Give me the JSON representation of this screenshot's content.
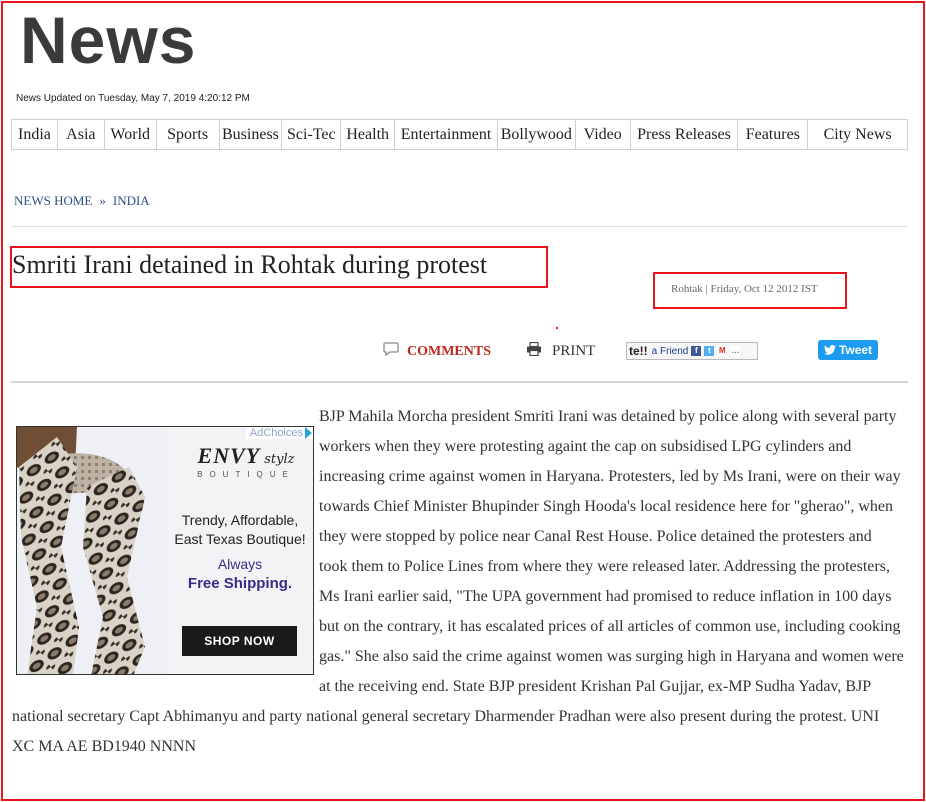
{
  "site": {
    "logo": "News",
    "updated": "News Updated on Tuesday, May 7, 2019 4:20:12 PM"
  },
  "nav": {
    "items": [
      {
        "label": "India"
      },
      {
        "label": "Asia"
      },
      {
        "label": "World"
      },
      {
        "label": "Sports"
      },
      {
        "label": "Business"
      },
      {
        "label": "Sci-Tec"
      },
      {
        "label": "Health"
      },
      {
        "label": "Entertainment"
      },
      {
        "label": "Bollywood"
      },
      {
        "label": "Video"
      },
      {
        "label": "Press Releases"
      },
      {
        "label": "Features"
      },
      {
        "label": "City News"
      }
    ]
  },
  "breadcrumb": {
    "home": "NEWS HOME",
    "separator": "»",
    "section": "INDIA"
  },
  "article": {
    "headline": "Smriti Irani detained in Rohtak during protest",
    "dateline": "Rohtak | Friday, Oct 12 2012 IST",
    "body": "BJP Mahila Morcha president Smriti Irani was detained by police along with several party workers when they were protesting againt the cap on subsidised LPG cylinders and increasing crime against women in Haryana. Protesters, led by Ms Irani, were on their way towards Chief Minister Bhupinder Singh Hooda's local residence here for \"gherao\", when they were stopped by police near Canal Rest House. Police detained the protesters and took them to Police Lines from where they were released later. Addressing the protesters, Ms Irani earlier said, \"The UPA government had promised to reduce inflation in 100 days but on the contrary, it has escalated prices of all articles of common use, including cooking gas.\" She also said the crime against women was surging high in Haryana and women were at the receiving end. State BJP president Krishan Pal Gujjar, ex-MP Sudha Yadav, BJP national secretary Capt Abhimanyu and party national general secretary Dharmender Pradhan were also present during the protest. UNI XC MA AE BD1940 NNNN"
  },
  "tools": {
    "comments_label": "COMMENTS",
    "print_label": "PRINT",
    "tell_prefix": "te!!",
    "tell_label": "a Friend",
    "tweet_label": "Tweet"
  },
  "ad": {
    "adchoices": "AdChoices",
    "brand_main": "ENVY",
    "brand_script": "stylz",
    "brand_sub": "BOUTIQUE",
    "line1": "Trendy, Affordable, East Texas Boutique!",
    "line2": "Always",
    "line3": "Free Shipping.",
    "cta": "SHOP NOW"
  },
  "colors": {
    "annotation_red": "#e8141c",
    "link_blue": "#2d4f86",
    "comments_red": "#c0281e",
    "twitter_blue": "#1d9bf0",
    "ad_purple": "#3c2a8a"
  }
}
